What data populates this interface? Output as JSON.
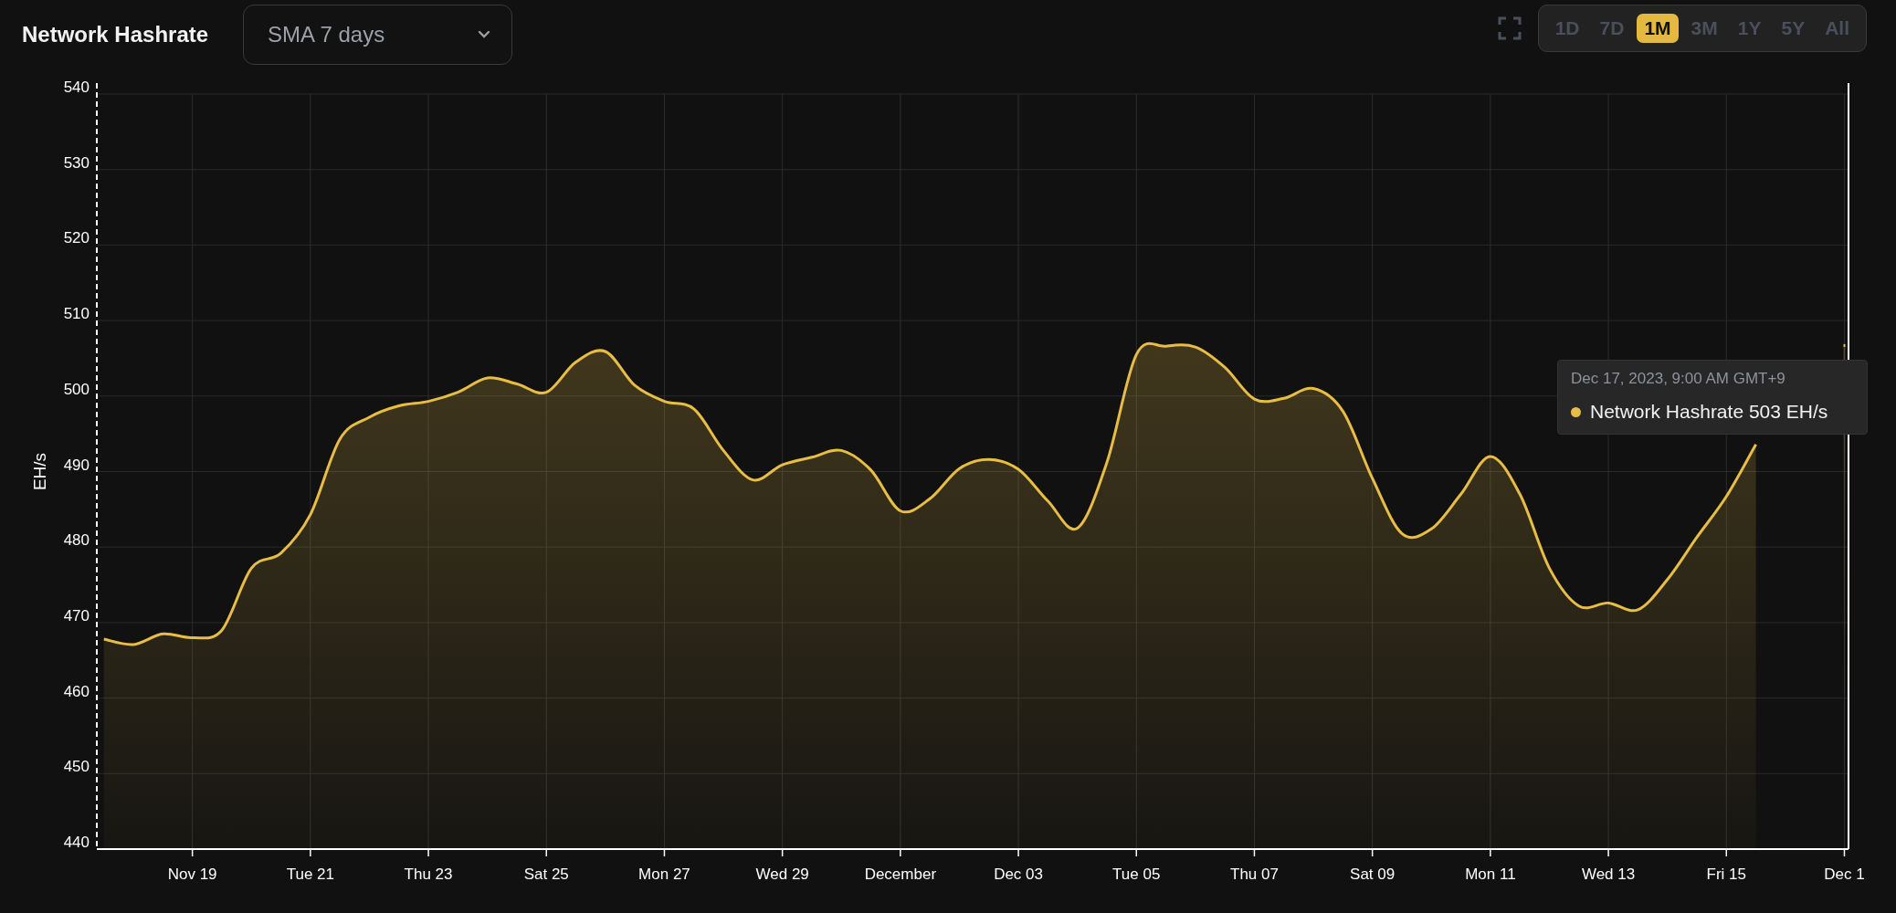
{
  "header": {
    "title": "Network Hashrate",
    "dropdown": {
      "value": "SMA 7 days"
    },
    "range_tabs": [
      {
        "label": "1D",
        "selected": false
      },
      {
        "label": "7D",
        "selected": false
      },
      {
        "label": "1M",
        "selected": true
      },
      {
        "label": "3M",
        "selected": false
      },
      {
        "label": "1Y",
        "selected": false
      },
      {
        "label": "5Y",
        "selected": false
      },
      {
        "label": "All",
        "selected": false
      }
    ]
  },
  "chart": {
    "chart_data": {
      "type": "area",
      "ylabel": "EH/s",
      "categories": [
        null,
        null,
        null,
        "Nov 19",
        null,
        null,
        null,
        "Tue 21",
        null,
        null,
        null,
        "Thu 23",
        null,
        null,
        null,
        "Sat 25",
        null,
        null,
        null,
        "Mon 27",
        null,
        null,
        null,
        "Wed 29",
        null,
        null,
        null,
        "December",
        null,
        null,
        null,
        "Dec 03",
        null,
        null,
        null,
        "Tue 05",
        null,
        null,
        null,
        "Thu 07",
        null,
        null,
        null,
        "Sat 09",
        null,
        null,
        null,
        "Mon 11",
        null,
        null,
        null,
        "Wed 13",
        null,
        null,
        null,
        "Fri 15",
        null,
        null,
        null,
        "Dec 1"
      ],
      "series": [
        {
          "name": "Network Hashrate",
          "color": "#e8bd45",
          "values": [
            467.8,
            467.1,
            468.5,
            468.0,
            469.0,
            477.2,
            479.2,
            484.3,
            494.3,
            497.2,
            498.7,
            499.3,
            500.5,
            502.4,
            501.6,
            500.5,
            504.5,
            505.9,
            501.4,
            499.3,
            498.3,
            492.8,
            488.9,
            490.9,
            491.9,
            492.8,
            490.2,
            484.8,
            486.4,
            490.4,
            491.6,
            490.3,
            486.1,
            482.5,
            491.2,
            505.5,
            506.6,
            506.5,
            503.8,
            499.6,
            499.7,
            501.0,
            498.0,
            489.1,
            481.8,
            482.4,
            487.0,
            492.0,
            487.0,
            477.2,
            472.2,
            472.6,
            471.7,
            475.7,
            481.3,
            486.7,
            493.6,
            null,
            null,
            506.7
          ]
        }
      ],
      "grid": true,
      "ylim": [
        440,
        540
      ],
      "yticks": [
        440,
        450,
        460,
        470,
        480,
        490,
        500,
        510,
        520,
        530,
        540
      ]
    },
    "tooltip": {
      "date": "Dec 17, 2023, 9:00 AM GMT+9",
      "value": "503 EH/s"
    }
  }
}
